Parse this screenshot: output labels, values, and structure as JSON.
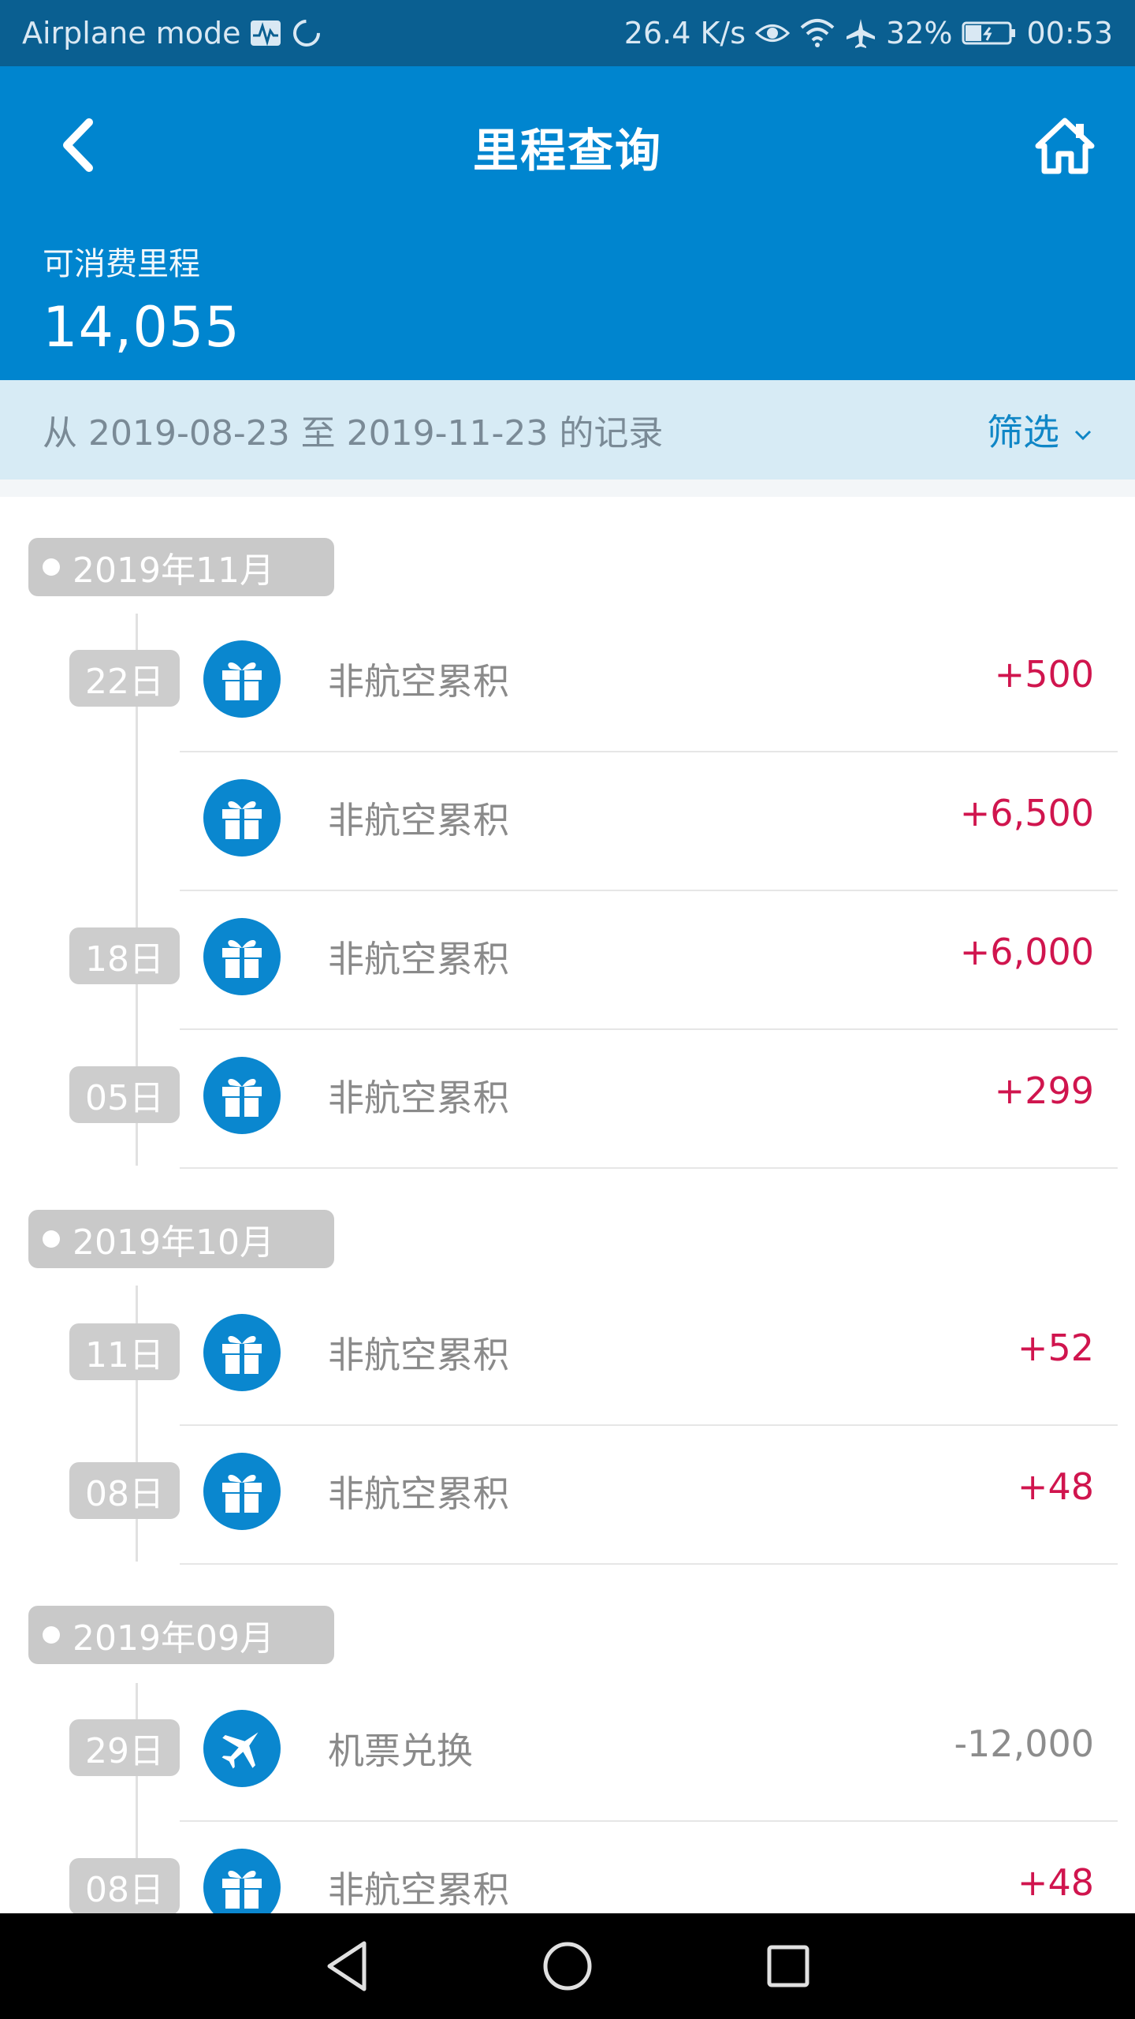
{
  "status_bar": {
    "airplane_label": "Airplane mode",
    "speed": "26.4 K/s",
    "battery": "32%",
    "time": "00:53",
    "icons": [
      "activity-icon",
      "sync-icon",
      "eye-icon",
      "wifi-icon",
      "airplane-icon",
      "battery-icon"
    ]
  },
  "header": {
    "title": "里程查询",
    "balance_label": "可消费里程",
    "balance_value": "14,055"
  },
  "filter": {
    "range_text": "从 2019-08-23 至 2019-11-23 的记录",
    "button_label": "筛选"
  },
  "months": [
    {
      "label": "2019年11月",
      "records": [
        {
          "day": "22日",
          "icon": "gift-icon",
          "type": "非航空累积",
          "amount": "+500"
        },
        {
          "day": "",
          "icon": "gift-icon",
          "type": "非航空累积",
          "amount": "+6,500"
        },
        {
          "day": "18日",
          "icon": "gift-icon",
          "type": "非航空累积",
          "amount": "+6,000"
        },
        {
          "day": "05日",
          "icon": "gift-icon",
          "type": "非航空累积",
          "amount": "+299"
        }
      ]
    },
    {
      "label": "2019年10月",
      "records": [
        {
          "day": "11日",
          "icon": "gift-icon",
          "type": "非航空累积",
          "amount": "+52"
        },
        {
          "day": "08日",
          "icon": "gift-icon",
          "type": "非航空累积",
          "amount": "+48"
        }
      ]
    },
    {
      "label": "2019年09月",
      "records": [
        {
          "day": "29日",
          "icon": "plane-icon",
          "type": "机票兑换",
          "amount": "-12,000"
        },
        {
          "day": "08日",
          "icon": "gift-icon",
          "type": "非航空累积",
          "amount": "+48"
        }
      ]
    }
  ],
  "colors": {
    "header_blue": "#0085cf",
    "status_bar": "#0a5f91",
    "positive_amount": "#d0154e",
    "negative_amount": "#8c8c8c",
    "filter_bg": "#d7ebf5"
  }
}
